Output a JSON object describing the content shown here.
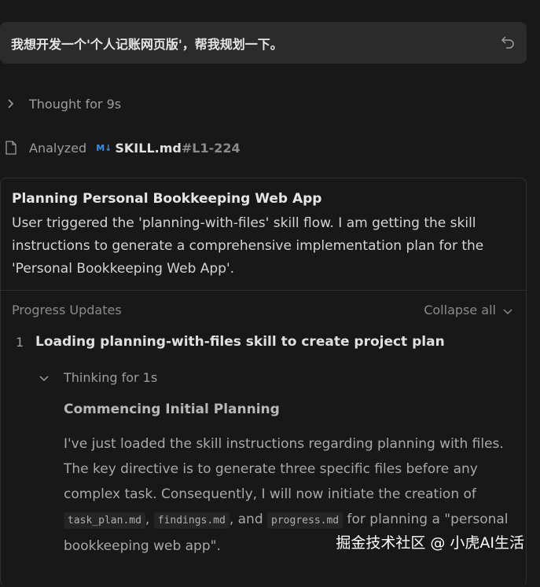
{
  "user_message": {
    "text": "我想开发一个'个人记账网页版'，帮我规划一下。",
    "undo_icon": "undo-arrow-icon"
  },
  "thought": {
    "label": "Thought for 9s"
  },
  "analyzed": {
    "label": "Analyzed",
    "badge": "M↓",
    "filename": "SKILL.md",
    "lines": "#L1-224"
  },
  "card": {
    "title": "Planning Personal Bookkeeping Web App",
    "description": "User triggered the 'planning-with-files' skill flow. I am getting the skill instructions to generate a comprehensive implementation plan for the 'Personal Bookkeeping Web App'.",
    "progress_label": "Progress Updates",
    "collapse_label": "Collapse all",
    "step": {
      "number": "1",
      "title": "Loading planning-with-files skill to create project plan",
      "thinking_label": "Thinking for 1s",
      "sub_title": "Commencing Initial Planning",
      "body_1": "I've just loaded the skill instructions regarding planning with files. The key directive is to generate three specific files before any complex task. Consequently, I will now initiate the creation of ",
      "code_1": "task_plan.md",
      "sep_1": ", ",
      "code_2": "findings.md",
      "sep_2": ", and ",
      "code_3": "progress.md",
      "body_2": " for planning a \"personal bookkeeping web app\"."
    }
  },
  "watermark": "掘金技术社区 @ 小虎AI生活",
  "colors": {
    "background": "#181818",
    "user_bubble": "#2b2b2b",
    "md_badge": "#3b8eea"
  }
}
